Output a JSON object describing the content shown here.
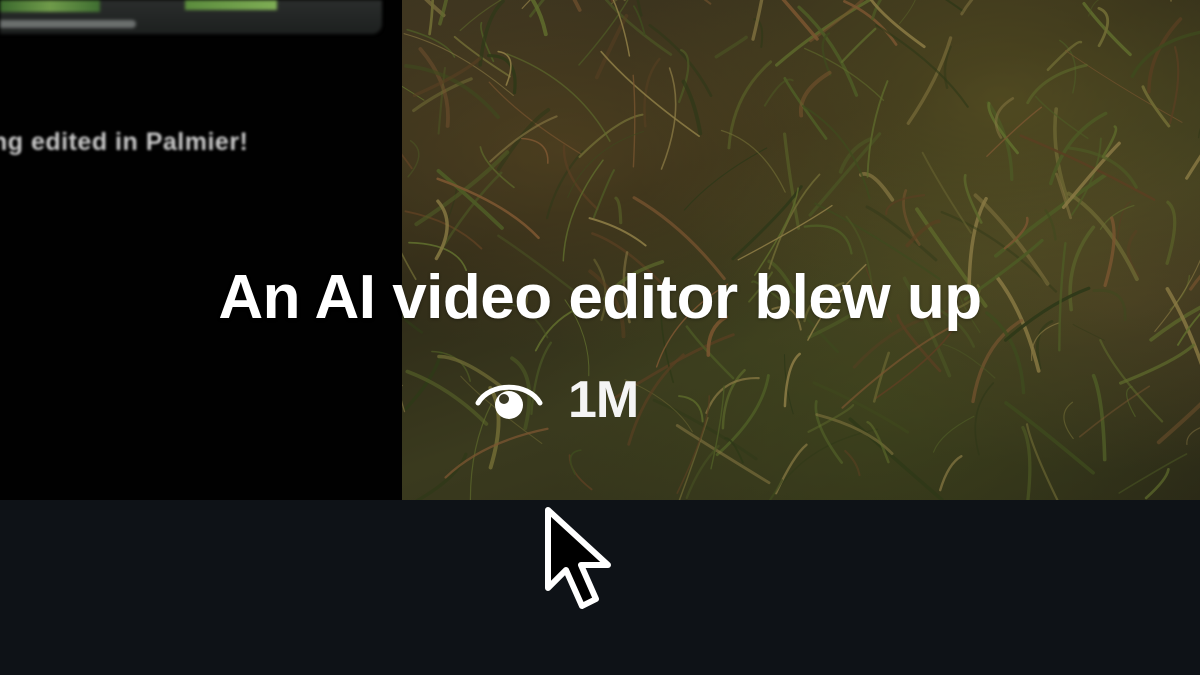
{
  "left_panel": {
    "caption": "ng edited in Palmier!"
  },
  "overlay": {
    "headline": "An AI video editor blew up",
    "views_icon": "eye-icon",
    "views_count": "1M"
  },
  "cursor_icon": "mouse-pointer-icon",
  "colors": {
    "bottom_bar": "#0e1217",
    "left_panel": "#010101",
    "text": "#ffffff"
  }
}
